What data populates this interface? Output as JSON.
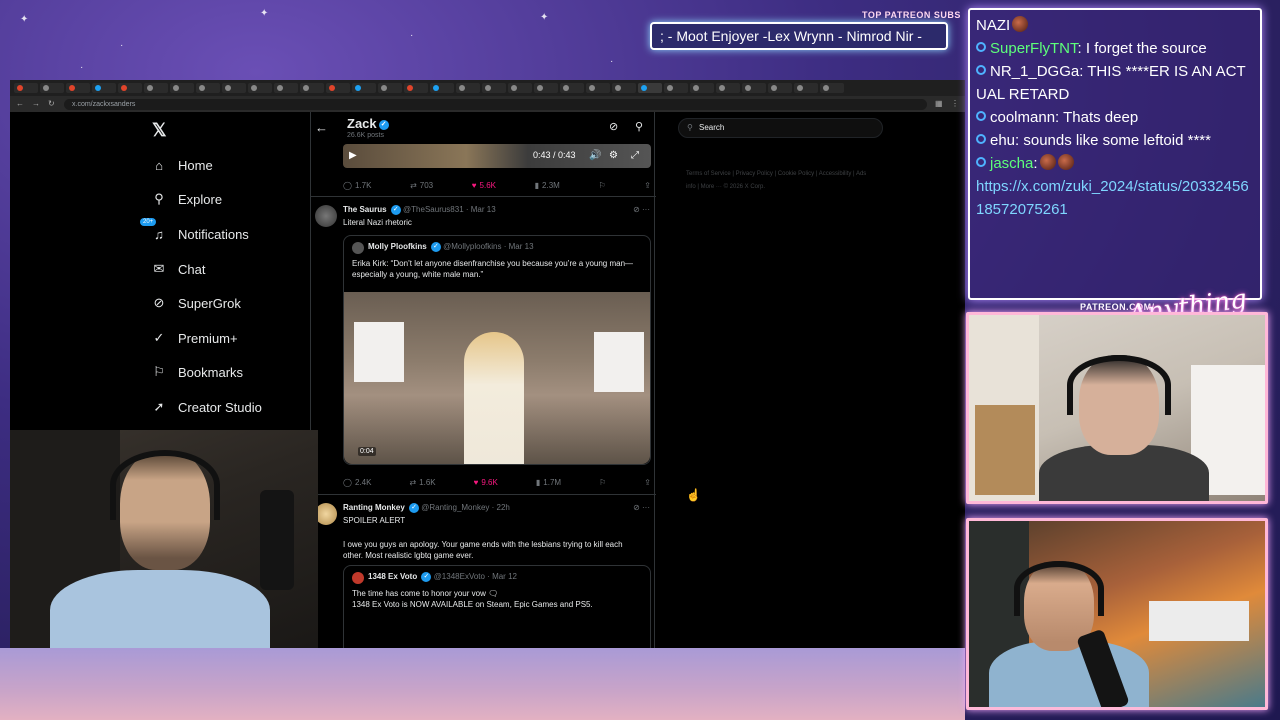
{
  "ticker": {
    "label": "TOP PATREON SUBS",
    "text": "; - Moot Enjoyer -Lex Wrynn - Nimrod Nir -"
  },
  "patreon_url_label": "PATREON.COM/",
  "script_logo": "Anything else?",
  "chat": {
    "messages": [
      {
        "user": "",
        "text": "NAZI",
        "emote": true
      },
      {
        "user": "SuperFlyTNT",
        "text": ": I forget the source",
        "user_color": "green"
      },
      {
        "user": "NR_1_DGGa",
        "text": ": THIS ****ER IS AN ACTUAL RETARD",
        "user_color": "white"
      },
      {
        "user": "coolmann",
        "text": ": Thats deep",
        "user_color": "white"
      },
      {
        "user": "ehu",
        "text": ": sounds like some leftoid ****",
        "user_color": "white"
      },
      {
        "user": "jascha",
        "text": ":",
        "user_color": "green",
        "emote": true
      },
      {
        "user": "",
        "text": "https://x.com/zuki_2024/status/2033245618572075261",
        "is_link": true
      }
    ]
  },
  "browser": {
    "url": "x.com/zackxsanders",
    "tab_colors": [
      "#e0442b",
      "#888",
      "#e0442b",
      "#1da1f2",
      "#e0442b",
      "#888",
      "#888",
      "#888",
      "#888",
      "#888",
      "#888",
      "#888",
      "#e0442b",
      "#1da1f2",
      "#888",
      "#e0442b",
      "#1da1f2",
      "#888",
      "#888",
      "#888",
      "#888",
      "#888",
      "#888",
      "#888",
      "#1da1f2",
      "#888",
      "#888",
      "#888",
      "#888",
      "#888",
      "#888",
      "#888"
    ]
  },
  "x": {
    "nav": [
      {
        "label": "Home",
        "icon": "home-icon",
        "glyph": "⌂"
      },
      {
        "label": "Explore",
        "icon": "search-icon",
        "glyph": "⌕"
      },
      {
        "label": "Notifications",
        "icon": "bell-icon",
        "glyph": "🔔",
        "badge": "20+"
      },
      {
        "label": "Chat",
        "icon": "mail-icon",
        "glyph": "✉"
      },
      {
        "label": "SuperGrok",
        "icon": "grok-icon",
        "glyph": "⊘"
      },
      {
        "label": "Premium+",
        "icon": "premium-icon",
        "glyph": "✓"
      },
      {
        "label": "Bookmarks",
        "icon": "bookmark-icon",
        "glyph": "⚐"
      },
      {
        "label": "Creator Studio",
        "icon": "rocket-icon",
        "glyph": "➚"
      }
    ],
    "profile": {
      "name": "Zack",
      "sub": "26.6K posts"
    },
    "video": {
      "time": "0:43 / 0:43"
    },
    "action_row_1": {
      "replies": "1.7K",
      "reposts": "703",
      "likes": "5.6K",
      "views": "2.3M"
    },
    "tweets": [
      {
        "name": "The Saurus",
        "handle": "@TheSaurus831 · Mar 13",
        "text": "Literal Nazi rhetoric",
        "quote": {
          "name": "Molly Ploofkins",
          "handle": "@Mollyploofkins · Mar 13",
          "text": "Erika Kirk: “Don’t let anyone disenfranchise you because you’re a young man—especially a young, white male man.”",
          "duration": "0:04"
        },
        "actions": {
          "replies": "2.4K",
          "reposts": "1.6K",
          "likes": "9.6K",
          "views": "1.7M"
        }
      },
      {
        "name": "Ranting Monkey",
        "handle": "@Ranting_Monkey · 22h",
        "text1": "SPOILER ALERT",
        "text2": "I owe you guys an apology. Your game ends with the lesbians trying to kill each other. Most realistic lgbtq game ever.",
        "quote": {
          "name": "1348 Ex Voto",
          "handle": "@1348ExVoto · Mar 12",
          "text": "The time has come to honor your vow 🗨\n1348 Ex Voto is NOW AVAILABLE on Steam, Epic Games and PS5."
        }
      }
    ],
    "search_placeholder": "Search",
    "footer": "Terms of Service | Privacy Policy | Cookie Policy | Accessibility | Ads info | More ··· © 2026 X Corp."
  },
  "colors": {
    "x_blue": "#1d9bf0",
    "like_pink": "#f91880",
    "chat_green": "#5dff7a",
    "cam_border": "#ffb8d8"
  }
}
